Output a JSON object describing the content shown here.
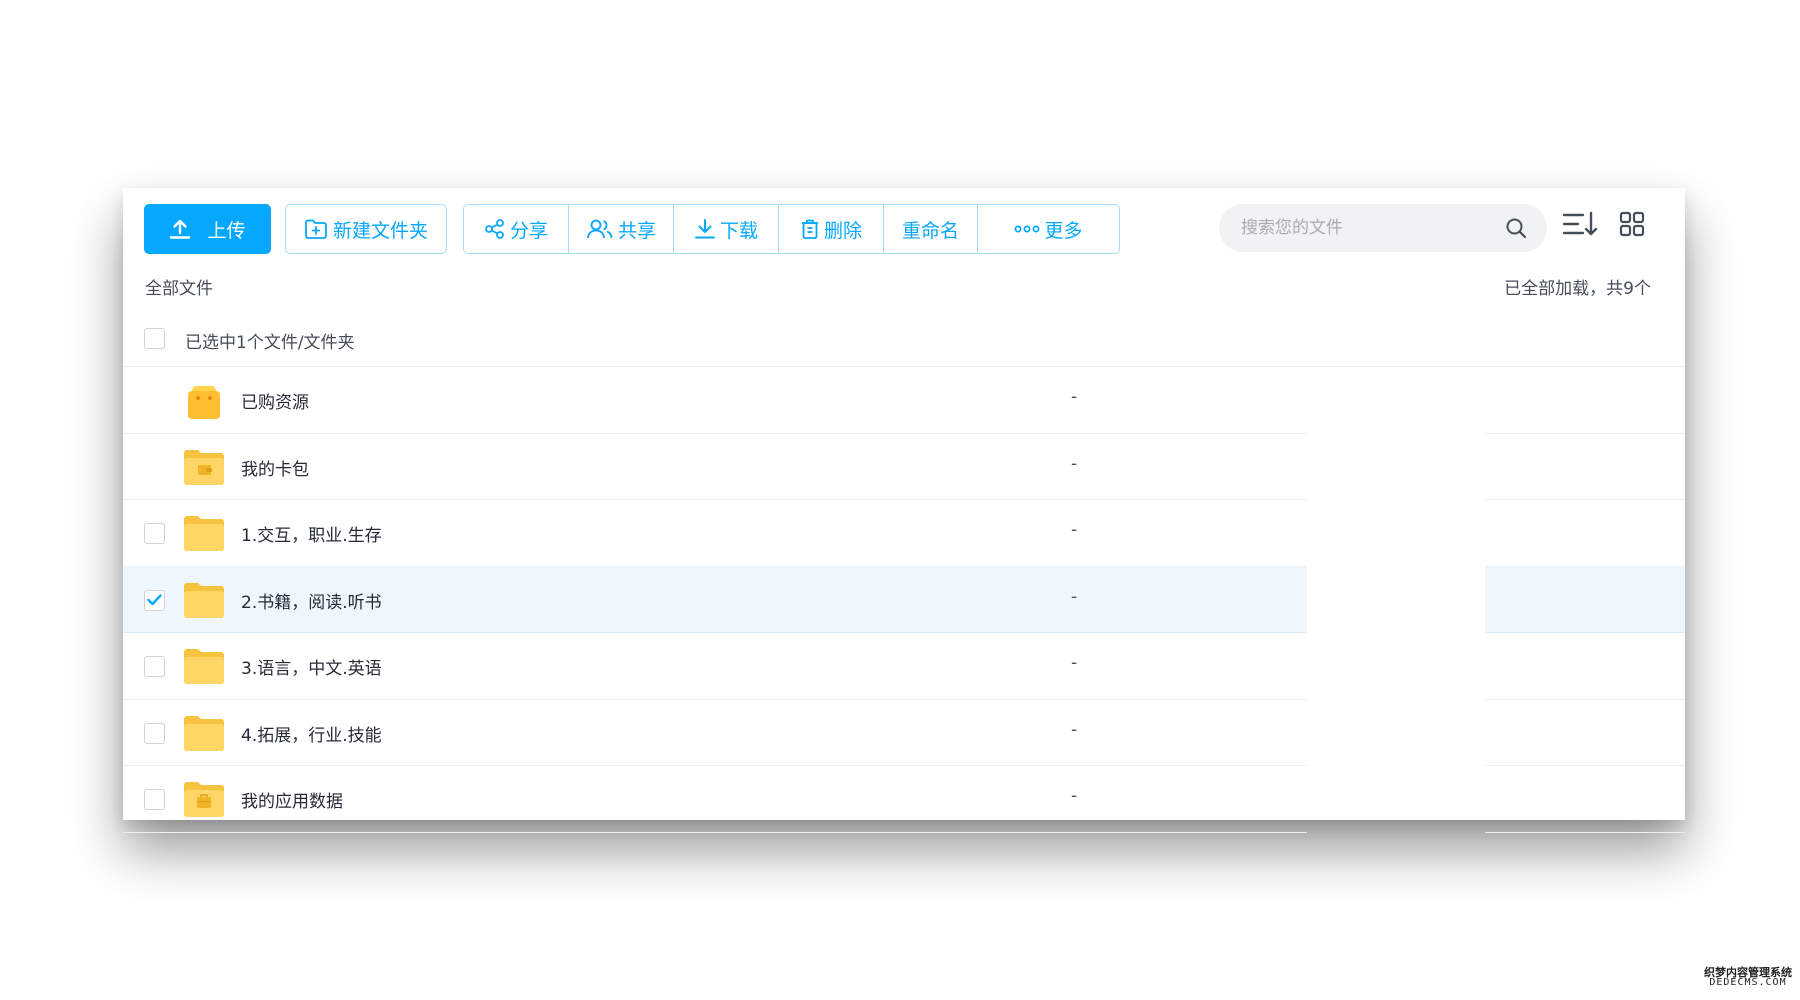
{
  "toolbar": {
    "upload_label": "上传",
    "new_folder_label": "新建文件夹",
    "actions": [
      {
        "label": "分享",
        "icon": "share-icon"
      },
      {
        "label": "共享",
        "icon": "users-icon"
      },
      {
        "label": "下载",
        "icon": "download-icon"
      },
      {
        "label": "删除",
        "icon": "trash-icon"
      },
      {
        "label": "重命名",
        "icon": ""
      },
      {
        "label": "更多",
        "icon": "more-icon"
      }
    ]
  },
  "search": {
    "placeholder": "搜索您的文件",
    "icon": "search-icon"
  },
  "view_controls": {
    "sort_icon": "sort-icon",
    "grid_icon": "grid-view-icon"
  },
  "breadcrumb": "全部文件",
  "load_status": "已全部加载，共9个",
  "selection": {
    "text": "已选中1个文件/文件夹",
    "checked": false
  },
  "files": [
    {
      "name": "已购资源",
      "size": "-",
      "icon": "shopping-bag-icon",
      "checkbox": false,
      "checked": false
    },
    {
      "name": "我的卡包",
      "size": "-",
      "icon": "card-wallet-folder-icon",
      "checkbox": false,
      "checked": false
    },
    {
      "name": "1.交互，职业.生存",
      "size": "-",
      "icon": "folder-icon",
      "checkbox": true,
      "checked": false
    },
    {
      "name": "2.书籍，阅读.听书",
      "size": "-",
      "icon": "folder-icon",
      "checkbox": true,
      "checked": true
    },
    {
      "name": "3.语言，中文.英语",
      "size": "-",
      "icon": "folder-icon",
      "checkbox": true,
      "checked": false
    },
    {
      "name": "4.拓展，行业.技能",
      "size": "-",
      "icon": "folder-icon",
      "checkbox": true,
      "checked": false
    },
    {
      "name": "我的应用数据",
      "size": "-",
      "icon": "app-data-folder-icon",
      "checkbox": true,
      "checked": false
    }
  ],
  "colors": {
    "accent": "#06a7ff",
    "folder": "#ffd666",
    "selected_row": "#eef7fe"
  },
  "watermark": {
    "line1": "织梦内容管理系统",
    "line2": "DEDECMS.COM"
  }
}
